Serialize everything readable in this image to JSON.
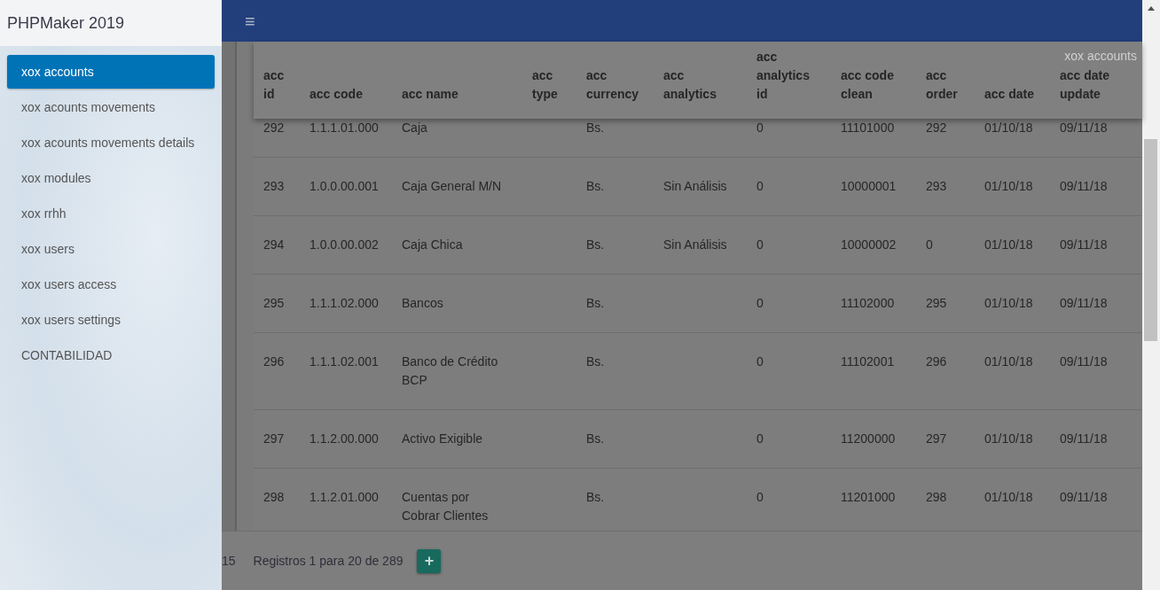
{
  "brand": "PHPMaker 2019",
  "menu": [
    {
      "label": "xox accounts",
      "selected": true
    },
    {
      "label": "xox acounts movements",
      "selected": false
    },
    {
      "label": "xox acounts movements details",
      "selected": false
    },
    {
      "label": "xox modules",
      "selected": false
    },
    {
      "label": "xox rrhh",
      "selected": false
    },
    {
      "label": "xox users",
      "selected": false
    },
    {
      "label": "xox users access",
      "selected": false
    },
    {
      "label": "xox users settings",
      "selected": false
    },
    {
      "label": "CONTABILIDAD",
      "selected": false
    }
  ],
  "topbar": {
    "menu_toggle": "≡"
  },
  "breadcrumb": "xox accounts",
  "table": {
    "columns": [
      "acc id",
      "acc code",
      "acc name",
      "acc type",
      "acc currency",
      "acc analytics",
      "acc analytics id",
      "acc code clean",
      "acc order",
      "acc date",
      "acc date update"
    ],
    "rows": [
      [
        "292",
        "1.1.1.01.000",
        "Caja",
        null,
        "Bs.",
        null,
        "0",
        "11101000",
        "292",
        "01/10/18",
        "09/11/18"
      ],
      [
        "293",
        "1.0.0.00.001",
        "Caja General M/N",
        null,
        "Bs.",
        "Sin Análisis",
        "0",
        "10000001",
        "293",
        "01/10/18",
        "09/11/18"
      ],
      [
        "294",
        "1.0.0.00.002",
        "Caja Chica",
        null,
        "Bs.",
        "Sin Análisis",
        "0",
        "10000002",
        "0",
        "01/10/18",
        "09/11/18"
      ],
      [
        "295",
        "1.1.1.02.000",
        "Bancos",
        null,
        "Bs.",
        null,
        "0",
        "11102000",
        "295",
        "01/10/18",
        "09/11/18"
      ],
      [
        "296",
        "1.1.1.02.001",
        "Banco de Crédito BCP",
        null,
        "Bs.",
        null,
        "0",
        "11102001",
        "296",
        "01/10/18",
        "09/11/18"
      ],
      [
        "297",
        "1.1.2.00.000",
        "Activo Exigible",
        null,
        "Bs.",
        null,
        "0",
        "11200000",
        "297",
        "01/10/18",
        "09/11/18"
      ],
      [
        "298",
        "1.1.2.01.000",
        "Cuentas por Cobrar Clientes",
        null,
        "Bs.",
        null,
        "0",
        "11201000",
        "298",
        "01/10/18",
        "09/11/18"
      ]
    ]
  },
  "footer": {
    "pager_fragment": "15",
    "records": "Registros 1 para 20 de 289",
    "add_button": "+"
  }
}
